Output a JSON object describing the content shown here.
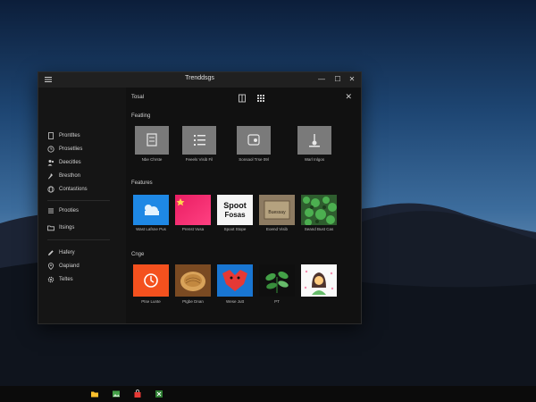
{
  "window": {
    "title": "Trenddsgs",
    "minimize_glyph": "—",
    "maximize_glyph": "☐",
    "close_glyph": "✕"
  },
  "sidebar": {
    "items": [
      {
        "label": "Prontltes",
        "icon": "bookmark-icon"
      },
      {
        "label": "Prosetlies",
        "icon": "clock-icon"
      },
      {
        "label": "Deecitles",
        "icon": "people-icon"
      },
      {
        "label": "Bresthon",
        "icon": "pin-icon"
      },
      {
        "label": "Contastions",
        "icon": "globe-icon"
      },
      {
        "label": "Prooties",
        "icon": "list-icon"
      },
      {
        "label": "Itsings",
        "icon": "folder-icon"
      },
      {
        "label": "Hafery",
        "icon": "pen-icon"
      },
      {
        "label": "Oapiand",
        "icon": "location-icon"
      },
      {
        "label": "Teltes",
        "icon": "settings-icon"
      }
    ]
  },
  "main": {
    "top_title": "Tosal",
    "close_glyph": "✕",
    "sections": {
      "s1": {
        "label": "Featling",
        "tiles": [
          {
            "caption": "Nbe Chrste"
          },
          {
            "caption": "Feeels Visib Fil"
          },
          {
            "caption": "Sonsaol Trse 09l"
          },
          {
            "caption": "Warl Inlgos"
          }
        ]
      },
      "s2": {
        "label": "Features",
        "tiles": [
          {
            "caption": "Wast Lafsne Pus"
          },
          {
            "caption": "Prenst Vusa"
          },
          {
            "caption": "Spoot Stope"
          },
          {
            "caption": "Eoend Visib"
          },
          {
            "caption": "Seand Bust Cas"
          }
        ]
      },
      "s3": {
        "label": "Cnge",
        "tiles": [
          {
            "caption": "Ptse Lunte"
          },
          {
            "caption": "Ptgbe Dnan"
          },
          {
            "caption": "Wese Jutt"
          },
          {
            "caption": "PT"
          },
          {
            "caption": ""
          }
        ]
      }
    },
    "art_text": {
      "spot_line1": "Spoot",
      "spot_line2": "Fosas",
      "box_text": "Buessay"
    }
  },
  "taskbar": {
    "items": [
      "file-explorer-icon",
      "photos-icon",
      "store-icon",
      "excel-icon"
    ]
  },
  "colors": {
    "accent_blue": "#1e88e5",
    "window_bg": "#1a1a1a"
  }
}
